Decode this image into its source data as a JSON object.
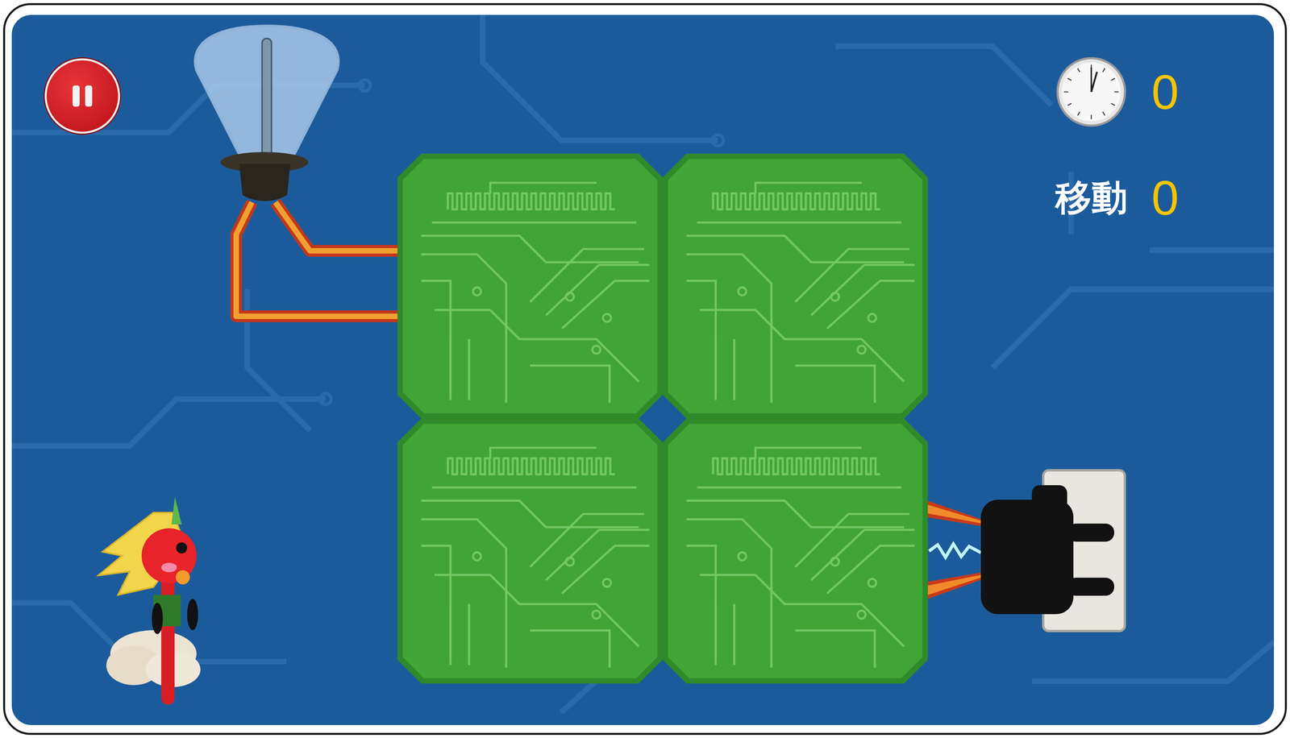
{
  "hud": {
    "time": "0",
    "moves_label": "移動",
    "moves": "0"
  },
  "bulb": {
    "lit": false
  },
  "plug": {
    "powered": true
  },
  "board": {
    "tiles": [
      {
        "kind": "circuit"
      },
      {
        "kind": "circuit"
      },
      {
        "kind": "circuit"
      },
      {
        "kind": "circuit"
      }
    ]
  }
}
